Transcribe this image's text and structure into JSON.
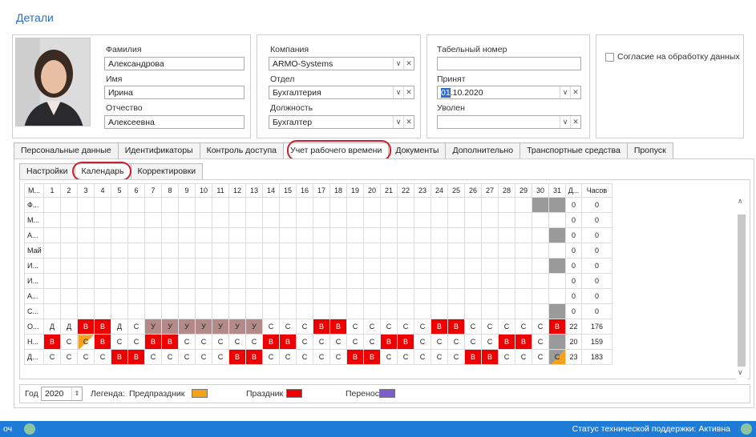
{
  "header": {
    "title": "Детали"
  },
  "personal": {
    "surname_label": "Фамилия",
    "surname": "Александрова",
    "name_label": "Имя",
    "name": "Ирина",
    "patronymic_label": "Отчество",
    "patronymic": "Алексеевна"
  },
  "company": {
    "company_label": "Компания",
    "company": "ARMO-Systems",
    "dept_label": "Отдел",
    "dept": "Бухгалтерия",
    "position_label": "Должность",
    "position": "Бухгалтер"
  },
  "employment": {
    "tab_no_label": "Табельный номер",
    "tab_no": "",
    "hired_label": "Принят",
    "hired_sel": "01",
    "hired_rest": ".10.2020",
    "fired_label": "Уволен",
    "fired": ""
  },
  "consent": {
    "label": "Согласие на обработку данных"
  },
  "tabs": [
    "Персональные данные",
    "Идентификаторы",
    "Контроль доступа",
    "Учет рабочего времени",
    "Документы",
    "Дополнительно",
    "Транспортные средства",
    "Пропуск"
  ],
  "subtabs": [
    "Настройки",
    "Календарь",
    "Корректировки"
  ],
  "grid": {
    "header": [
      "М...",
      "1",
      "2",
      "3",
      "4",
      "5",
      "6",
      "7",
      "8",
      "9",
      "10",
      "11",
      "12",
      "13",
      "14",
      "15",
      "16",
      "17",
      "18",
      "19",
      "20",
      "21",
      "22",
      "23",
      "24",
      "25",
      "26",
      "27",
      "28",
      "29",
      "30",
      "31",
      "Д...",
      "Часов"
    ],
    "rows": [
      {
        "m": "Ф...",
        "d": "0",
        "h": "0",
        "cells": [
          [
            "",
            ""
          ],
          [
            "",
            ""
          ],
          [
            "",
            ""
          ],
          [
            "",
            ""
          ],
          [
            "",
            ""
          ],
          [
            "",
            ""
          ],
          [
            "",
            ""
          ],
          [
            "",
            ""
          ],
          [
            "",
            ""
          ],
          [
            "",
            ""
          ],
          [
            "",
            ""
          ],
          [
            "",
            ""
          ],
          [
            "",
            ""
          ],
          [
            "",
            ""
          ],
          [
            "",
            ""
          ],
          [
            "",
            ""
          ],
          [
            "",
            ""
          ],
          [
            "",
            ""
          ],
          [
            "",
            ""
          ],
          [
            "",
            ""
          ],
          [
            "",
            ""
          ],
          [
            "",
            ""
          ],
          [
            "",
            ""
          ],
          [
            "",
            ""
          ],
          [
            "",
            ""
          ],
          [
            "",
            ""
          ],
          [
            "",
            ""
          ],
          [
            "",
            ""
          ],
          [
            "",
            ""
          ],
          [
            "",
            "gry"
          ],
          [
            "",
            "gry"
          ]
        ]
      },
      {
        "m": "М...",
        "d": "0",
        "h": "0",
        "cells": []
      },
      {
        "m": "А...",
        "d": "0",
        "h": "0",
        "cells": [
          [
            "",
            ""
          ],
          [
            "",
            ""
          ],
          [
            "",
            ""
          ],
          [
            "",
            ""
          ],
          [
            "",
            ""
          ],
          [
            "",
            ""
          ],
          [
            "",
            ""
          ],
          [
            "",
            ""
          ],
          [
            "",
            ""
          ],
          [
            "",
            ""
          ],
          [
            "",
            ""
          ],
          [
            "",
            ""
          ],
          [
            "",
            ""
          ],
          [
            "",
            ""
          ],
          [
            "",
            ""
          ],
          [
            "",
            ""
          ],
          [
            "",
            ""
          ],
          [
            "",
            ""
          ],
          [
            "",
            ""
          ],
          [
            "",
            ""
          ],
          [
            "",
            ""
          ],
          [
            "",
            ""
          ],
          [
            "",
            ""
          ],
          [
            "",
            ""
          ],
          [
            "",
            ""
          ],
          [
            "",
            ""
          ],
          [
            "",
            ""
          ],
          [
            "",
            ""
          ],
          [
            "",
            ""
          ],
          [
            "",
            ""
          ],
          [
            "",
            "gry"
          ]
        ]
      },
      {
        "m": "Май",
        "d": "0",
        "h": "0",
        "cells": []
      },
      {
        "m": "И...",
        "d": "0",
        "h": "0",
        "cells": [
          [
            "",
            ""
          ],
          [
            "",
            ""
          ],
          [
            "",
            ""
          ],
          [
            "",
            ""
          ],
          [
            "",
            ""
          ],
          [
            "",
            ""
          ],
          [
            "",
            ""
          ],
          [
            "",
            ""
          ],
          [
            "",
            ""
          ],
          [
            "",
            ""
          ],
          [
            "",
            ""
          ],
          [
            "",
            ""
          ],
          [
            "",
            ""
          ],
          [
            "",
            ""
          ],
          [
            "",
            ""
          ],
          [
            "",
            ""
          ],
          [
            "",
            ""
          ],
          [
            "",
            ""
          ],
          [
            "",
            ""
          ],
          [
            "",
            ""
          ],
          [
            "",
            ""
          ],
          [
            "",
            ""
          ],
          [
            "",
            ""
          ],
          [
            "",
            ""
          ],
          [
            "",
            ""
          ],
          [
            "",
            ""
          ],
          [
            "",
            ""
          ],
          [
            "",
            ""
          ],
          [
            "",
            ""
          ],
          [
            "",
            ""
          ],
          [
            "",
            "gry"
          ]
        ]
      },
      {
        "m": "И...",
        "d": "0",
        "h": "0",
        "cells": []
      },
      {
        "m": "А...",
        "d": "0",
        "h": "0",
        "cells": []
      },
      {
        "m": "С...",
        "d": "0",
        "h": "0",
        "cells": [
          [
            "",
            ""
          ],
          [
            "",
            ""
          ],
          [
            "",
            ""
          ],
          [
            "",
            ""
          ],
          [
            "",
            ""
          ],
          [
            "",
            ""
          ],
          [
            "",
            ""
          ],
          [
            "",
            ""
          ],
          [
            "",
            ""
          ],
          [
            "",
            ""
          ],
          [
            "",
            ""
          ],
          [
            "",
            ""
          ],
          [
            "",
            ""
          ],
          [
            "",
            ""
          ],
          [
            "",
            ""
          ],
          [
            "",
            ""
          ],
          [
            "",
            ""
          ],
          [
            "",
            ""
          ],
          [
            "",
            ""
          ],
          [
            "",
            ""
          ],
          [
            "",
            ""
          ],
          [
            "",
            ""
          ],
          [
            "",
            ""
          ],
          [
            "",
            ""
          ],
          [
            "",
            ""
          ],
          [
            "",
            ""
          ],
          [
            "",
            ""
          ],
          [
            "",
            ""
          ],
          [
            "",
            ""
          ],
          [
            "",
            ""
          ],
          [
            "",
            "gry"
          ]
        ]
      },
      {
        "m": "О...",
        "d": "22",
        "h": "176",
        "cells": [
          [
            "Д",
            ""
          ],
          [
            "Д",
            ""
          ],
          [
            "В",
            "red"
          ],
          [
            "В",
            "red"
          ],
          [
            "Д",
            ""
          ],
          [
            "С",
            ""
          ],
          [
            "У",
            "brn"
          ],
          [
            "У",
            "brn"
          ],
          [
            "У",
            "brn"
          ],
          [
            "У",
            "brn"
          ],
          [
            "У",
            "brn"
          ],
          [
            "У",
            "brn"
          ],
          [
            "У",
            "brn"
          ],
          [
            "С",
            ""
          ],
          [
            "С",
            ""
          ],
          [
            "С",
            ""
          ],
          [
            "В",
            "red"
          ],
          [
            "В",
            "red"
          ],
          [
            "С",
            ""
          ],
          [
            "С",
            ""
          ],
          [
            "С",
            ""
          ],
          [
            "С",
            ""
          ],
          [
            "С",
            ""
          ],
          [
            "В",
            "red"
          ],
          [
            "В",
            "red"
          ],
          [
            "С",
            ""
          ],
          [
            "С",
            ""
          ],
          [
            "С",
            ""
          ],
          [
            "С",
            ""
          ],
          [
            "С",
            ""
          ],
          [
            "В",
            "red"
          ]
        ]
      },
      {
        "m": "Н...",
        "d": "20",
        "h": "159",
        "cells": [
          [
            "В",
            "red"
          ],
          [
            "С",
            ""
          ],
          [
            "С",
            "half"
          ],
          [
            "В",
            "red"
          ],
          [
            "С",
            ""
          ],
          [
            "С",
            ""
          ],
          [
            "В",
            "red"
          ],
          [
            "В",
            "red"
          ],
          [
            "С",
            ""
          ],
          [
            "С",
            ""
          ],
          [
            "С",
            ""
          ],
          [
            "С",
            ""
          ],
          [
            "С",
            ""
          ],
          [
            "В",
            "red"
          ],
          [
            "В",
            "red"
          ],
          [
            "С",
            ""
          ],
          [
            "С",
            ""
          ],
          [
            "С",
            ""
          ],
          [
            "С",
            ""
          ],
          [
            "С",
            ""
          ],
          [
            "В",
            "red"
          ],
          [
            "В",
            "red"
          ],
          [
            "С",
            ""
          ],
          [
            "С",
            ""
          ],
          [
            "С",
            ""
          ],
          [
            "С",
            ""
          ],
          [
            "С",
            ""
          ],
          [
            "В",
            "red"
          ],
          [
            "В",
            "red"
          ],
          [
            "С",
            ""
          ],
          [
            "",
            "gry"
          ]
        ]
      },
      {
        "m": "Д...",
        "d": "23",
        "h": "183",
        "cells": [
          [
            "С",
            ""
          ],
          [
            "С",
            ""
          ],
          [
            "С",
            ""
          ],
          [
            "С",
            ""
          ],
          [
            "В",
            "red"
          ],
          [
            "В",
            "red"
          ],
          [
            "С",
            ""
          ],
          [
            "С",
            ""
          ],
          [
            "С",
            ""
          ],
          [
            "С",
            ""
          ],
          [
            "С",
            ""
          ],
          [
            "В",
            "red"
          ],
          [
            "В",
            "red"
          ],
          [
            "С",
            ""
          ],
          [
            "С",
            ""
          ],
          [
            "С",
            ""
          ],
          [
            "С",
            ""
          ],
          [
            "С",
            ""
          ],
          [
            "В",
            "red"
          ],
          [
            "В",
            "red"
          ],
          [
            "С",
            ""
          ],
          [
            "С",
            ""
          ],
          [
            "С",
            ""
          ],
          [
            "С",
            ""
          ],
          [
            "С",
            ""
          ],
          [
            "В",
            "red"
          ],
          [
            "В",
            "red"
          ],
          [
            "С",
            ""
          ],
          [
            "С",
            ""
          ],
          [
            "С",
            ""
          ],
          [
            "С",
            "half2"
          ]
        ]
      }
    ]
  },
  "footer": {
    "year_label": "Год",
    "year": "2020",
    "legend_label": "Легенда:",
    "l1": "Предпраздник",
    "l2": "Праздник",
    "l3": "Перенос",
    "c1": "#f4a21c",
    "c2": "#ee0000",
    "c3": "#7a5ed0"
  },
  "status": {
    "left": "оч",
    "right": "Статус технической поддержки: Активна"
  }
}
